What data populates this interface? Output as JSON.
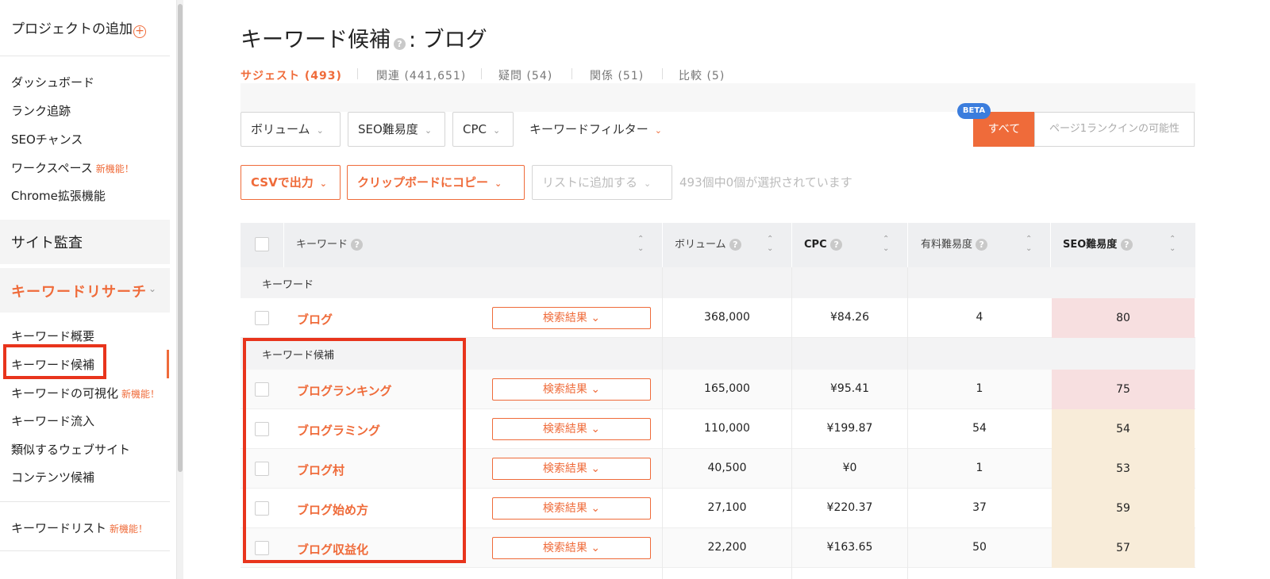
{
  "sidebar": {
    "add_project": "プロジェクトの追加",
    "items_top": [
      {
        "label": "ダッシュボード"
      },
      {
        "label": "ランク追跡"
      },
      {
        "label": "SEOチャンス"
      },
      {
        "label": "ワークスペース",
        "badge": "新機能！"
      },
      {
        "label": "Chrome拡張機能"
      }
    ],
    "section_site_audit": "サイト監査",
    "section_keyword_research": "キーワードリサーチ",
    "items_kr": [
      {
        "label": "キーワード概要"
      },
      {
        "label": "キーワード候補"
      },
      {
        "label": "キーワードの可視化",
        "badge": "新機能！"
      },
      {
        "label": "キーワード流入"
      },
      {
        "label": "類似するウェブサイト"
      },
      {
        "label": "コンテンツ候補"
      }
    ],
    "keyword_list": "キーワードリスト",
    "keyword_list_badge": "新機能！"
  },
  "header": {
    "title_main": "キーワード候補",
    "title_help": "?",
    "title_suffix": ": ブログ"
  },
  "tabs": [
    {
      "label": "サジェスト (493)",
      "active": true
    },
    {
      "label": "関連 (441,651)",
      "active": false
    },
    {
      "label": "疑問 (54)",
      "active": false
    },
    {
      "label": "関係 (51)",
      "active": false
    },
    {
      "label": "比較 (5)",
      "active": false
    }
  ],
  "filters": {
    "volume": "ボリューム",
    "seo_difficulty": "SEO難易度",
    "cpc": "CPC",
    "keyword_filter": "キーワードフィルター",
    "beta": "BETA",
    "all": "すべて",
    "page1": "ページ1ランクインの可能性"
  },
  "actions": {
    "csv": "CSVで出力",
    "clipboard": "クリップボードにコピー",
    "add_list": "リストに追加する",
    "selection_status": "493個中0個が選択されています"
  },
  "table": {
    "headers": {
      "keyword": "キーワード",
      "volume": "ボリューム",
      "cpc": "CPC",
      "paid_difficulty": "有料難易度",
      "seo_difficulty": "SEO難易度"
    },
    "group_keyword": "キーワード",
    "group_suggestions": "キーワード候補",
    "serp_label": "検索結果",
    "main_row": {
      "keyword": "ブログ",
      "volume": "368,000",
      "cpc": "¥84.26",
      "paid": "4",
      "seo": "80",
      "seo_color": "#f7dfe0"
    },
    "rows": [
      {
        "keyword": "ブログランキング",
        "volume": "165,000",
        "cpc": "¥95.41",
        "paid": "1",
        "seo": "75",
        "seo_color": "#f7dfe0"
      },
      {
        "keyword": "ブログラミング",
        "volume": "110,000",
        "cpc": "¥199.87",
        "paid": "54",
        "seo": "54",
        "seo_color": "#f8ecd9"
      },
      {
        "keyword": "ブログ村",
        "volume": "40,500",
        "cpc": "¥0",
        "paid": "1",
        "seo": "53",
        "seo_color": "#f8ecd9"
      },
      {
        "keyword": "ブログ始め方",
        "volume": "27,100",
        "cpc": "¥220.37",
        "paid": "37",
        "seo": "59",
        "seo_color": "#f8ecd9"
      },
      {
        "keyword": "ブログ収益化",
        "volume": "22,200",
        "cpc": "¥163.65",
        "paid": "50",
        "seo": "57",
        "seo_color": "#f8ecd9"
      }
    ]
  },
  "colors": {
    "accent": "#ef6b3a",
    "highlight_box": "#e8341c"
  }
}
